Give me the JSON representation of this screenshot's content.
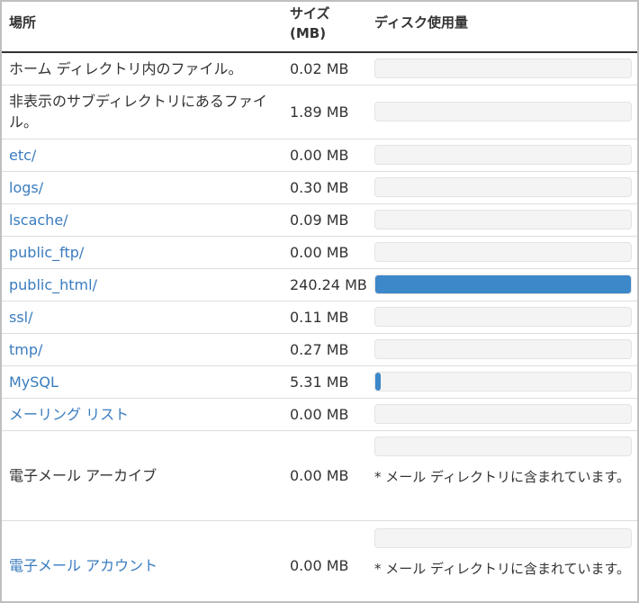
{
  "header": {
    "location": "場所",
    "size_line1": "サイズ",
    "size_line2": "(MB)",
    "disk_usage": "ディスク使用量"
  },
  "rows": [
    {
      "name": "ホーム ディレクトリ内のファイル。",
      "link": false,
      "size": "0.02 MB",
      "usage": 0.0
    },
    {
      "name": "非表示のサブディレクトリにあるファイル。",
      "link": false,
      "size": "1.89 MB",
      "usage": 0.0
    },
    {
      "name": "etc/",
      "link": true,
      "size": "0.00 MB",
      "usage": 0.0
    },
    {
      "name": "logs/",
      "link": true,
      "size": "0.30 MB",
      "usage": 0.0
    },
    {
      "name": "lscache/",
      "link": true,
      "size": "0.09 MB",
      "usage": 0.0
    },
    {
      "name": "public_ftp/",
      "link": true,
      "size": "0.00 MB",
      "usage": 0.0
    },
    {
      "name": "public_html/",
      "link": true,
      "size": "240.24 MB",
      "usage": 1.0
    },
    {
      "name": "ssl/",
      "link": true,
      "size": "0.11 MB",
      "usage": 0.0
    },
    {
      "name": "tmp/",
      "link": true,
      "size": "0.27 MB",
      "usage": 0.0
    },
    {
      "name": "MySQL",
      "link": true,
      "size": "5.31 MB",
      "usage": 0.022
    },
    {
      "name": "メーリング リスト",
      "link": true,
      "size": "0.00 MB",
      "usage": 0.0
    },
    {
      "name": "電子メール アーカイブ",
      "link": false,
      "size": "0.00 MB",
      "usage": 0.0,
      "note": "* メール ディレクトリに含まれています。"
    },
    {
      "name": "電子メール アカウント",
      "link": true,
      "size": "0.00 MB",
      "usage": 0.0,
      "note": "* メール ディレクトリに含まれています。"
    }
  ],
  "colors": {
    "link": "#3a7cbf",
    "bar_fill": "#3d88c9",
    "bar_track": "#f4f4f4"
  }
}
